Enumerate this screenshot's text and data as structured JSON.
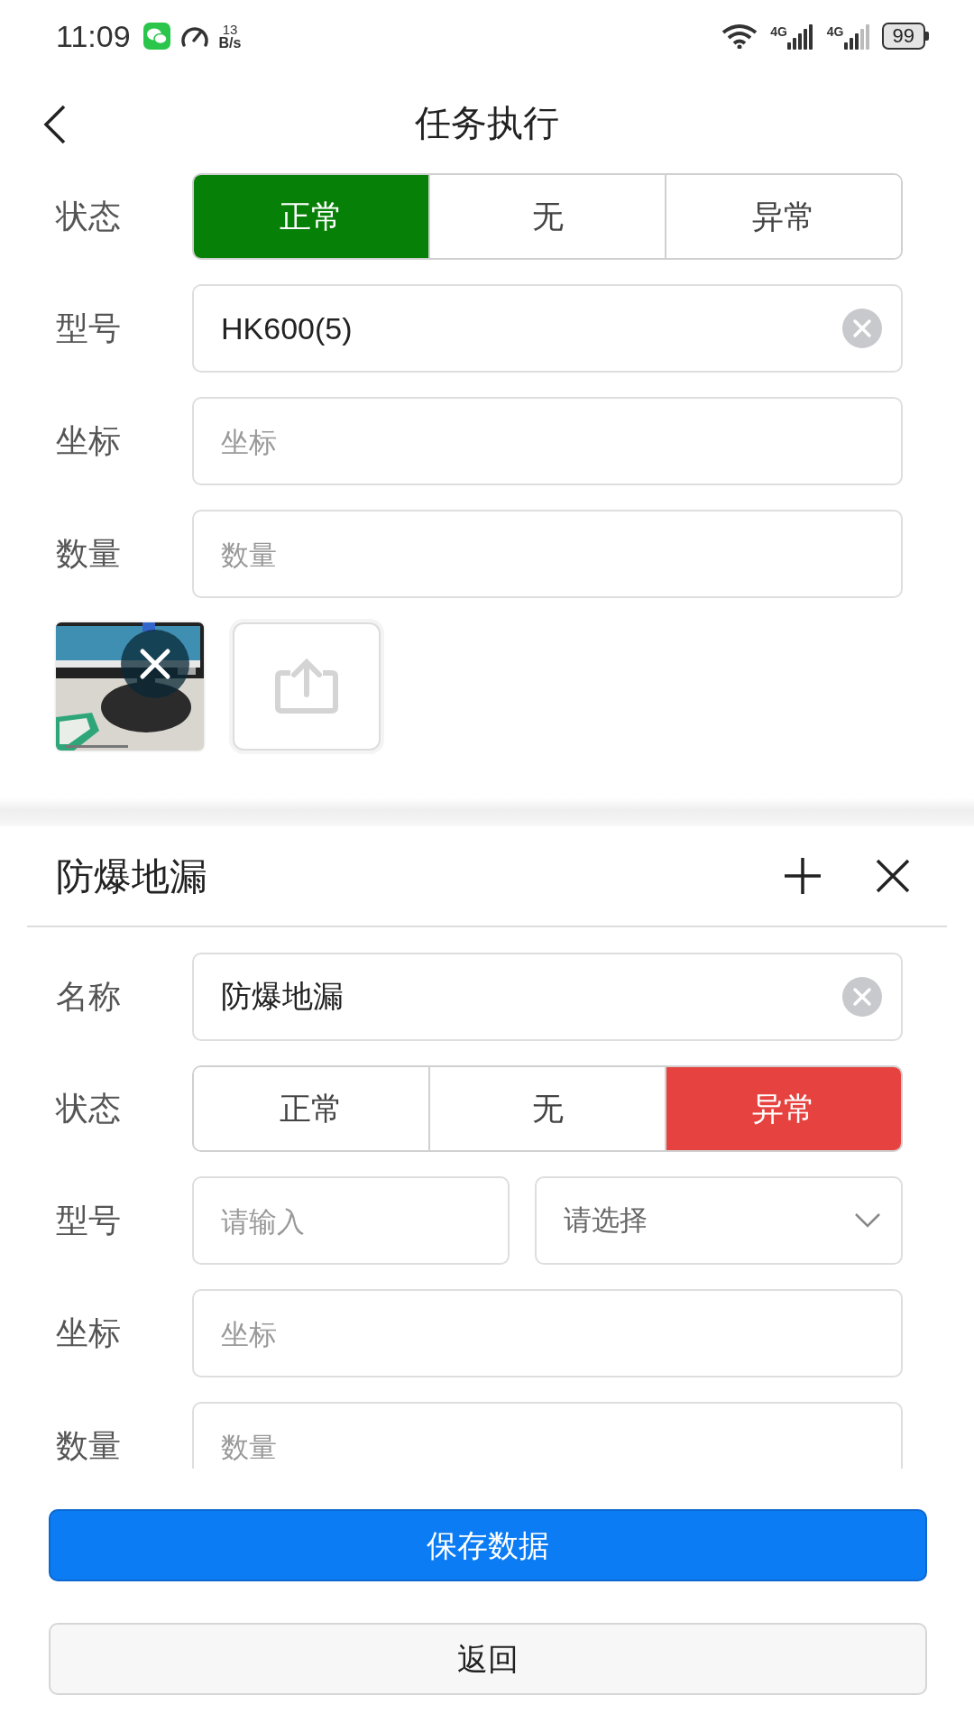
{
  "status_bar": {
    "time": "11:09",
    "net_speed_value": "13",
    "net_speed_unit": "B/s",
    "network_1": "4G",
    "network_2": "4G",
    "battery": "99"
  },
  "header": {
    "title": "任务执行"
  },
  "section_1": {
    "rows": [
      {
        "kind": "segment",
        "label": "状态",
        "options": [
          {
            "label": "正常",
            "selected": true,
            "color": "#078007"
          },
          {
            "label": "无",
            "selected": false
          },
          {
            "label": "异常",
            "selected": false
          }
        ]
      },
      {
        "kind": "input",
        "label": "型号",
        "value": "HK600(5)",
        "clearable": true
      },
      {
        "kind": "input",
        "label": "坐标",
        "placeholder": "坐标"
      },
      {
        "kind": "input",
        "label": "数量",
        "placeholder": "数量"
      }
    ],
    "photos": [
      {
        "kind": "picture",
        "removable": true
      }
    ]
  },
  "section_2": {
    "title": "防爆地漏",
    "rows": [
      {
        "kind": "input",
        "label": "名称",
        "value": "防爆地漏",
        "clearable": true
      },
      {
        "kind": "segment",
        "label": "状态",
        "options": [
          {
            "label": "正常",
            "selected": false
          },
          {
            "label": "无",
            "selected": false
          },
          {
            "label": "异常",
            "selected": true,
            "color": "#e64340"
          }
        ]
      },
      {
        "kind": "split",
        "label": "型号",
        "input_placeholder": "请输入",
        "select_placeholder": "请选择"
      },
      {
        "kind": "input",
        "label": "坐标",
        "placeholder": "坐标"
      },
      {
        "kind": "input",
        "label": "数量",
        "placeholder": "数量"
      }
    ]
  },
  "buttons": [
    {
      "label": "保存数据",
      "kind": "primary"
    },
    {
      "label": "返回",
      "kind": "secondary"
    }
  ]
}
